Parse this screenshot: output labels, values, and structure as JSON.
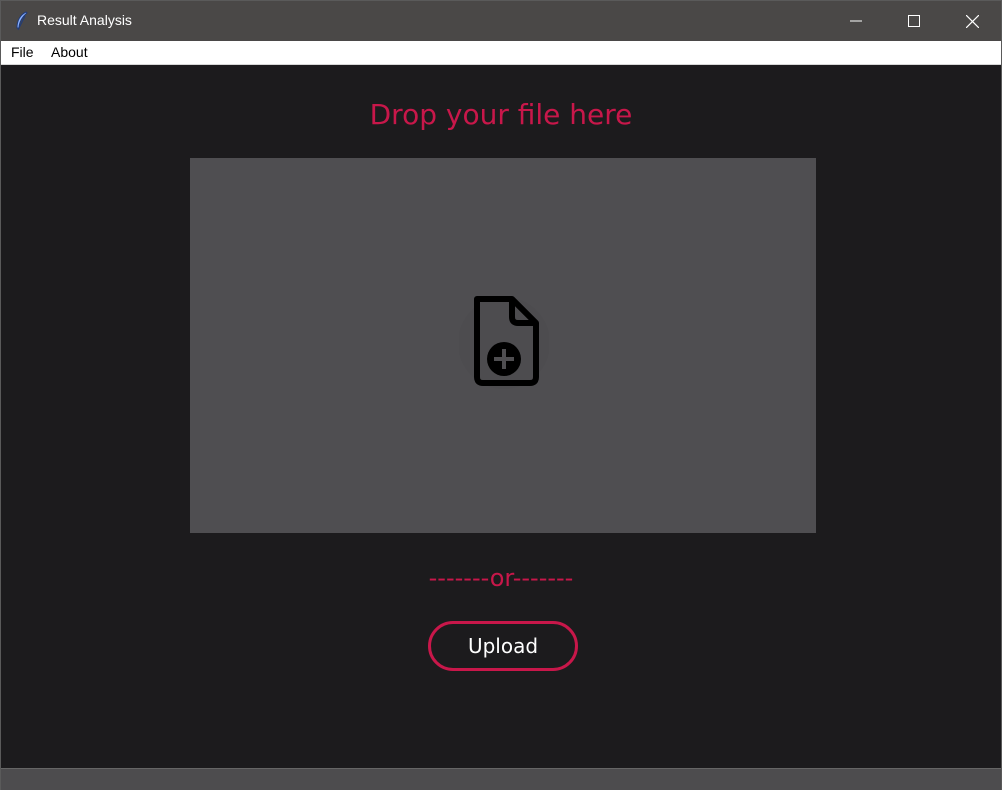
{
  "window": {
    "title": "Result Analysis",
    "icons": {
      "app": "feather-icon",
      "minimize": "minimize-icon",
      "maximize": "maximize-icon",
      "close": "close-icon"
    }
  },
  "menubar": {
    "items": [
      {
        "label": "File"
      },
      {
        "label": "About"
      }
    ]
  },
  "main": {
    "drop_title": "Drop your file here",
    "drop_zone_icon": "file-add-icon",
    "or_divider": "-------or-------",
    "upload_label": "Upload"
  },
  "colors": {
    "accent": "#c8174a",
    "background": "#1c1b1d",
    "drop_zone": "#4f4e51",
    "titlebar": "#4a4847"
  }
}
